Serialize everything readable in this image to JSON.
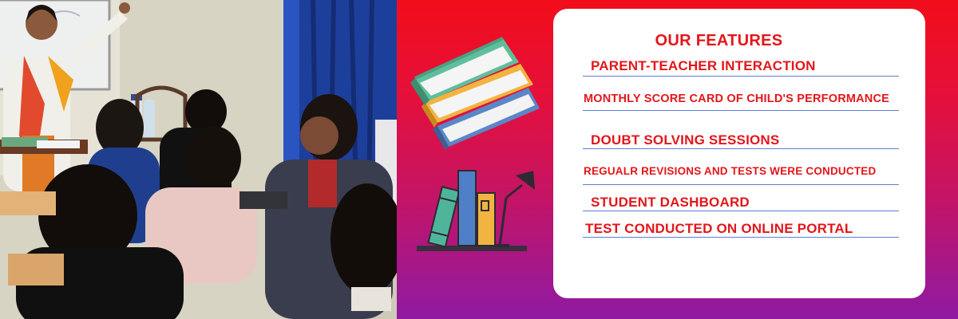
{
  "features_card": {
    "title": "OUR FEATURES",
    "items": [
      "PARENT-TEACHER INTERACTION",
      "MONTHLY SCORE CARD OF CHILD'S  PERFORMANCE",
      "DOUBT SOLVING SESSIONS",
      "REGUALR REVISIONS AND TESTS WERE CONDUCTED",
      "STUDENT DASHBOARD",
      "TEST CONDUCTED ON ONLINE PORTAL"
    ]
  },
  "colors": {
    "background_top": "#f20d1a",
    "background_bottom": "#8f1aa3",
    "feature_text": "#e3161b",
    "underline": "#5b7fd6",
    "card": "#ffffff"
  },
  "illustrations": {
    "photo": "classroom-photo",
    "stacked_books": "stacked-books-illustration",
    "shelf_books_lamp": "books-and-lamp-illustration"
  }
}
